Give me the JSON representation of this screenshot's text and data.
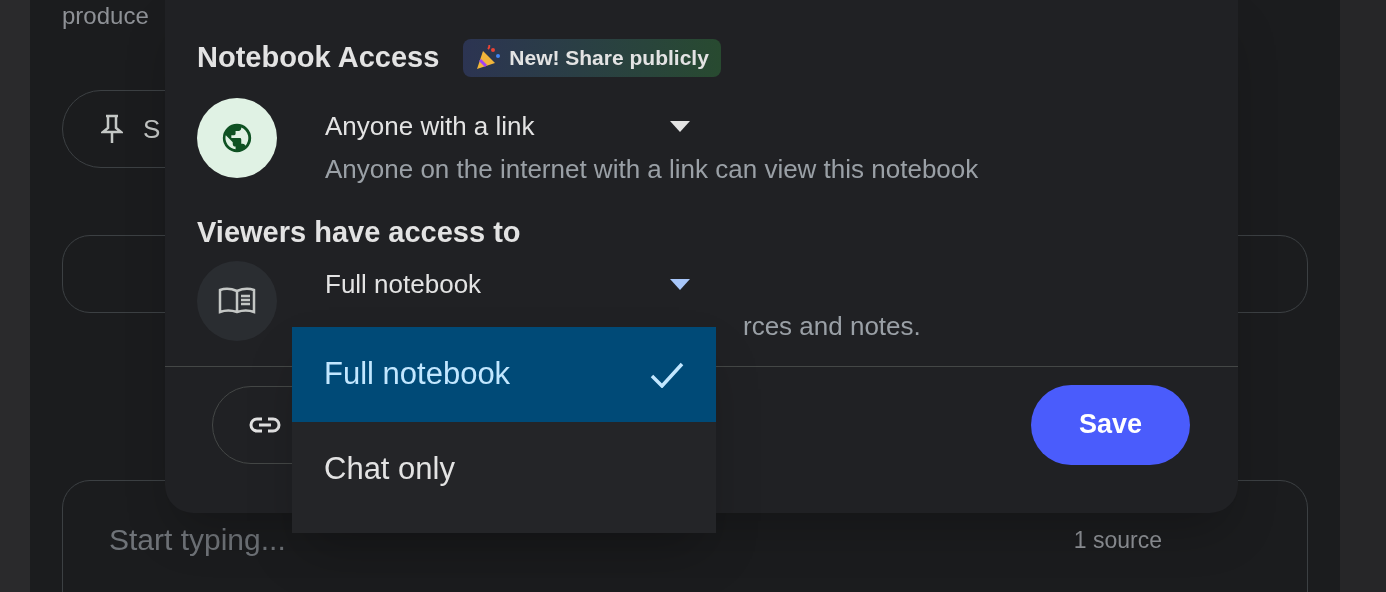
{
  "background": {
    "intro_text": "produce",
    "pinned_button": {
      "label": "S"
    },
    "composer": {
      "placeholder": "Start typing...",
      "source_count": "1 source"
    }
  },
  "dialog": {
    "title": "Notebook Access",
    "badge": "New! Share publicly",
    "access": {
      "value": "Anyone with a link",
      "description": "Anyone on the internet with a link can view this notebook"
    },
    "viewers": {
      "heading": "Viewers have access to",
      "value": "Full notebook",
      "expanded": true,
      "description": "rces and notes.",
      "menu": [
        {
          "label": "Full notebook",
          "selected": true
        },
        {
          "label": "Chat only",
          "selected": false
        }
      ]
    },
    "save_button": "Save"
  }
}
